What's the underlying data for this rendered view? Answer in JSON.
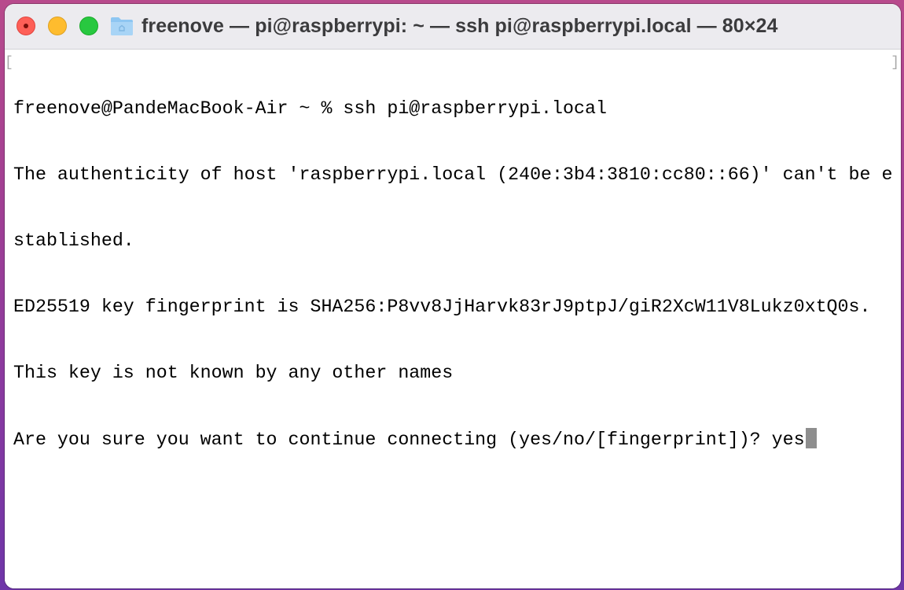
{
  "window": {
    "title": "freenove — pi@raspberrypi: ~ — ssh pi@raspberrypi.local — 80×24",
    "title_icon": "folder-icon",
    "controls": [
      "close",
      "minimize",
      "zoom"
    ],
    "colors": {
      "close": "#fe5f57",
      "minimize": "#febc2e",
      "zoom": "#28c840"
    }
  },
  "terminal": {
    "lines": [
      "freenove@PandeMacBook-Air ~ % ssh pi@raspberrypi.local",
      "The authenticity of host 'raspberrypi.local (240e:3b4:3810:cc80::66)' can't be e",
      "stablished.",
      "ED25519 key fingerprint is SHA256:P8vv8JjHarvk83rJ9ptpJ/giR2XcW11V8Lukz0xtQ0s.",
      "This key is not known by any other names",
      "Are you sure you want to continue connecting (yes/no/[fingerprint])? yes"
    ],
    "left_bracket": "[",
    "right_bracket": "]"
  }
}
